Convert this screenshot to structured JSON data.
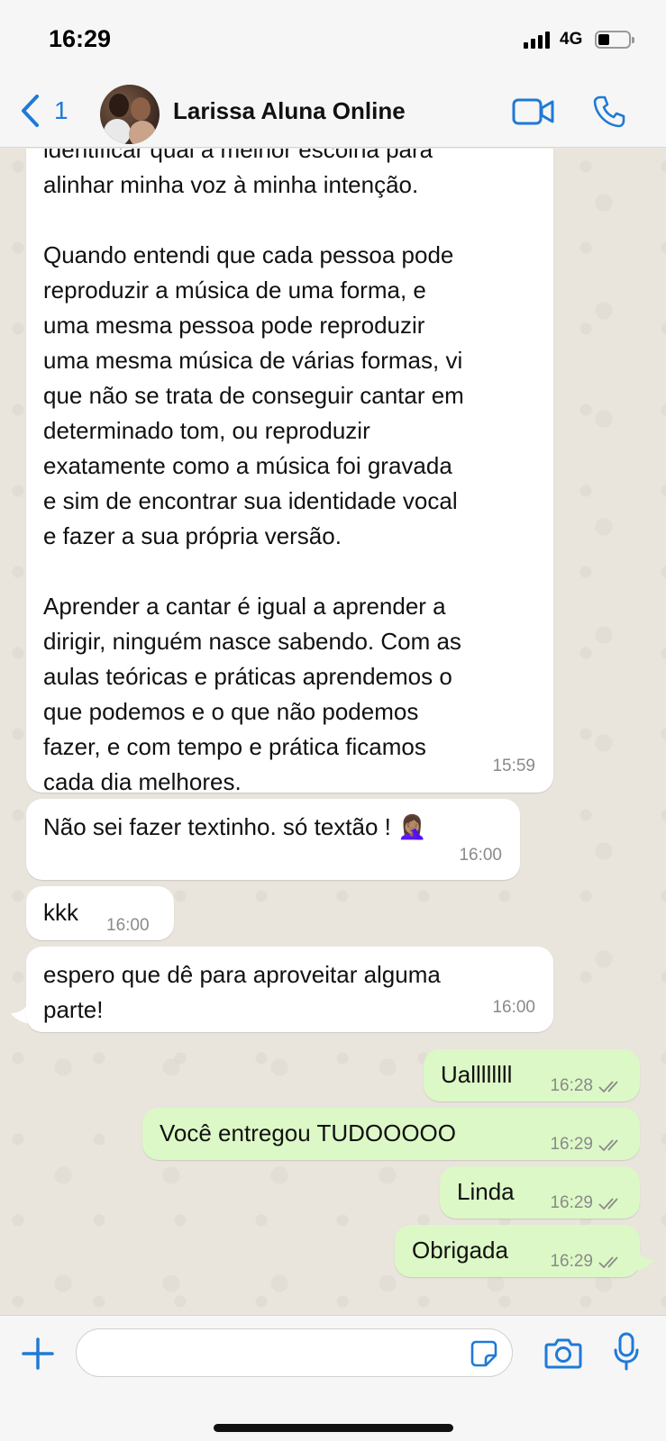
{
  "status_bar": {
    "time": "16:29",
    "network": "4G"
  },
  "header": {
    "back_count": "1",
    "contact_name": "Larissa Aluna Online"
  },
  "messages": [
    {
      "direction": "incoming",
      "text": "identificar qual a melhor escolha para\nalinhar minha voz à minha intenção.\n\nQuando entendi que cada pessoa pode\nreproduzir a música de uma forma, e\numa mesma pessoa pode reproduzir\numa mesma música de várias formas, vi\nque não se trata de conseguir cantar em\ndeterminado tom, ou reproduzir\nexatamente como a música foi gravada\ne sim de encontrar sua identidade vocal\ne fazer a sua própria versão.\n\nAprender a cantar é igual a aprender a\ndirigir, ninguém nasce sabendo. Com as\naulas teóricas e práticas aprendemos o\nque podemos e o que não podemos\nfazer, e com tempo e prática ficamos\ncada dia melhores.",
      "time": "15:59"
    },
    {
      "direction": "incoming",
      "text": "Não sei fazer textinho. só textão ! 🤦🏽‍♀️",
      "time": "16:00"
    },
    {
      "direction": "incoming",
      "text": "kkk",
      "time": "16:00"
    },
    {
      "direction": "incoming",
      "text": "espero que dê para aproveitar alguma\nparte!",
      "time": "16:00"
    },
    {
      "direction": "outgoing",
      "text": "Uallllllll",
      "time": "16:28",
      "status": "read"
    },
    {
      "direction": "outgoing",
      "text": "Você entregou TUDOOOOO",
      "time": "16:29",
      "status": "read"
    },
    {
      "direction": "outgoing",
      "text": "Linda",
      "time": "16:29",
      "status": "read"
    },
    {
      "direction": "outgoing",
      "text": "Obrigada",
      "time": "16:29",
      "status": "read"
    }
  ],
  "input": {
    "value": "",
    "placeholder": ""
  },
  "colors": {
    "accent": "#1f7ad6",
    "incoming_bubble": "#ffffff",
    "outgoing_bubble": "#dcf8c6",
    "chat_background": "#e9e4dc"
  },
  "icons": [
    "back-chevron-icon",
    "video-call-icon",
    "phone-icon",
    "plus-icon",
    "sticker-icon",
    "camera-icon",
    "microphone-icon",
    "read-ticks-icon"
  ]
}
